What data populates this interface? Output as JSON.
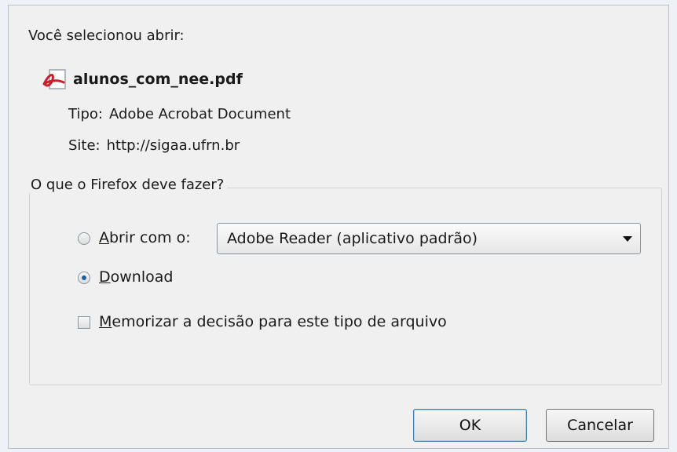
{
  "dialog": {
    "intro": "Você selecionou abrir:",
    "file_name": "alunos_com_nee.pdf",
    "file_icon": "pdf-file-icon",
    "type_label": "Tipo:",
    "type_value": "Adobe Acrobat Document",
    "site_label": "Site:",
    "site_value": "http://sigaa.ufrn.br"
  },
  "action_group": {
    "legend": "O que o Firefox deve fazer?",
    "open_with": {
      "mnemonic": "A",
      "rest": "brir com o:",
      "selected": false
    },
    "app_select": {
      "value": "Adobe Reader  (aplicativo padrão)"
    },
    "download": {
      "mnemonic": "D",
      "rest": "ownload",
      "selected": true
    },
    "remember": {
      "mnemonic": "M",
      "rest": "emorizar a decisão para este tipo de arquivo",
      "checked": false
    }
  },
  "buttons": {
    "ok": "OK",
    "cancel": "Cancelar"
  }
}
